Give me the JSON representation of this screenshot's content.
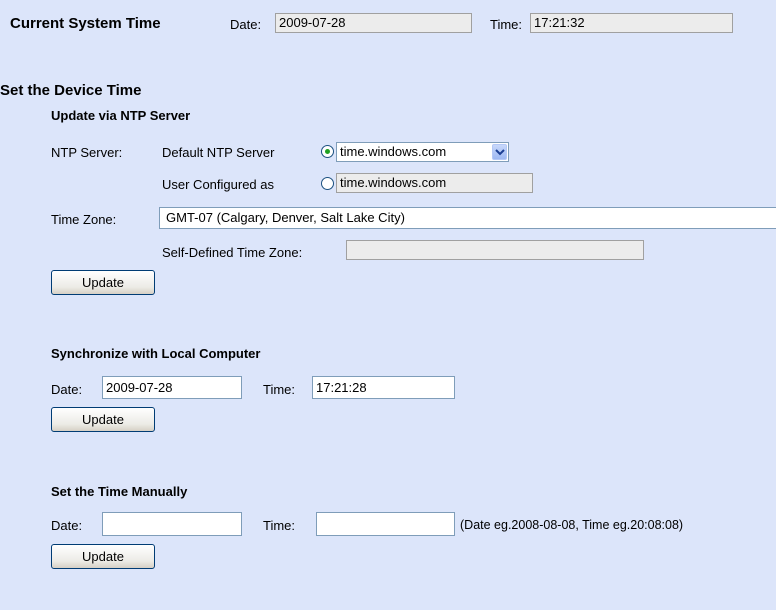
{
  "current_time": {
    "heading": "Current System Time",
    "date_label": "Date:",
    "date_value": "2009-07-28",
    "time_label": "Time:",
    "time_value": "17:21:32"
  },
  "device_time": {
    "heading": "Set the Device Time",
    "ntp": {
      "heading": "Update via NTP Server",
      "server_label": "NTP Server:",
      "default_label": "Default NTP Server",
      "default_value": "time.windows.com",
      "user_label": "User Configured as",
      "user_value": "time.windows.com",
      "timezone_label": "Time Zone:",
      "timezone_value": "GMT-07 (Calgary, Denver, Salt Lake City)",
      "self_tz_label": "Self-Defined Time Zone:",
      "self_tz_value": "",
      "update_label": "Update"
    },
    "sync": {
      "heading": "Synchronize with Local Computer",
      "date_label": "Date:",
      "date_value": "2009-07-28",
      "time_label": "Time:",
      "time_value": "17:21:28",
      "update_label": "Update"
    },
    "manual": {
      "heading": "Set the Time Manually",
      "date_label": "Date:",
      "date_value": "",
      "time_label": "Time:",
      "time_value": "",
      "hint": "(Date eg.2008-08-08, Time eg.20:08:08)",
      "update_label": "Update"
    }
  },
  "colors": {
    "panel_bg": "#dce5fa",
    "radio_checked": "#21a121"
  },
  "icons": {
    "dropdown": "chevron-down-icon"
  }
}
